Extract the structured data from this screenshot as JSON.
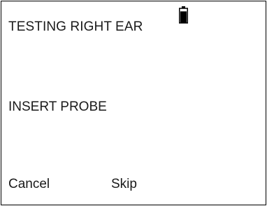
{
  "header": {
    "title": "TESTING RIGHT EAR",
    "battery_icon": "battery-icon",
    "battery_level": 0.85
  },
  "main": {
    "instruction": "INSERT PROBE"
  },
  "softkeys": {
    "cancel_label": "Cancel",
    "skip_label": "Skip"
  }
}
